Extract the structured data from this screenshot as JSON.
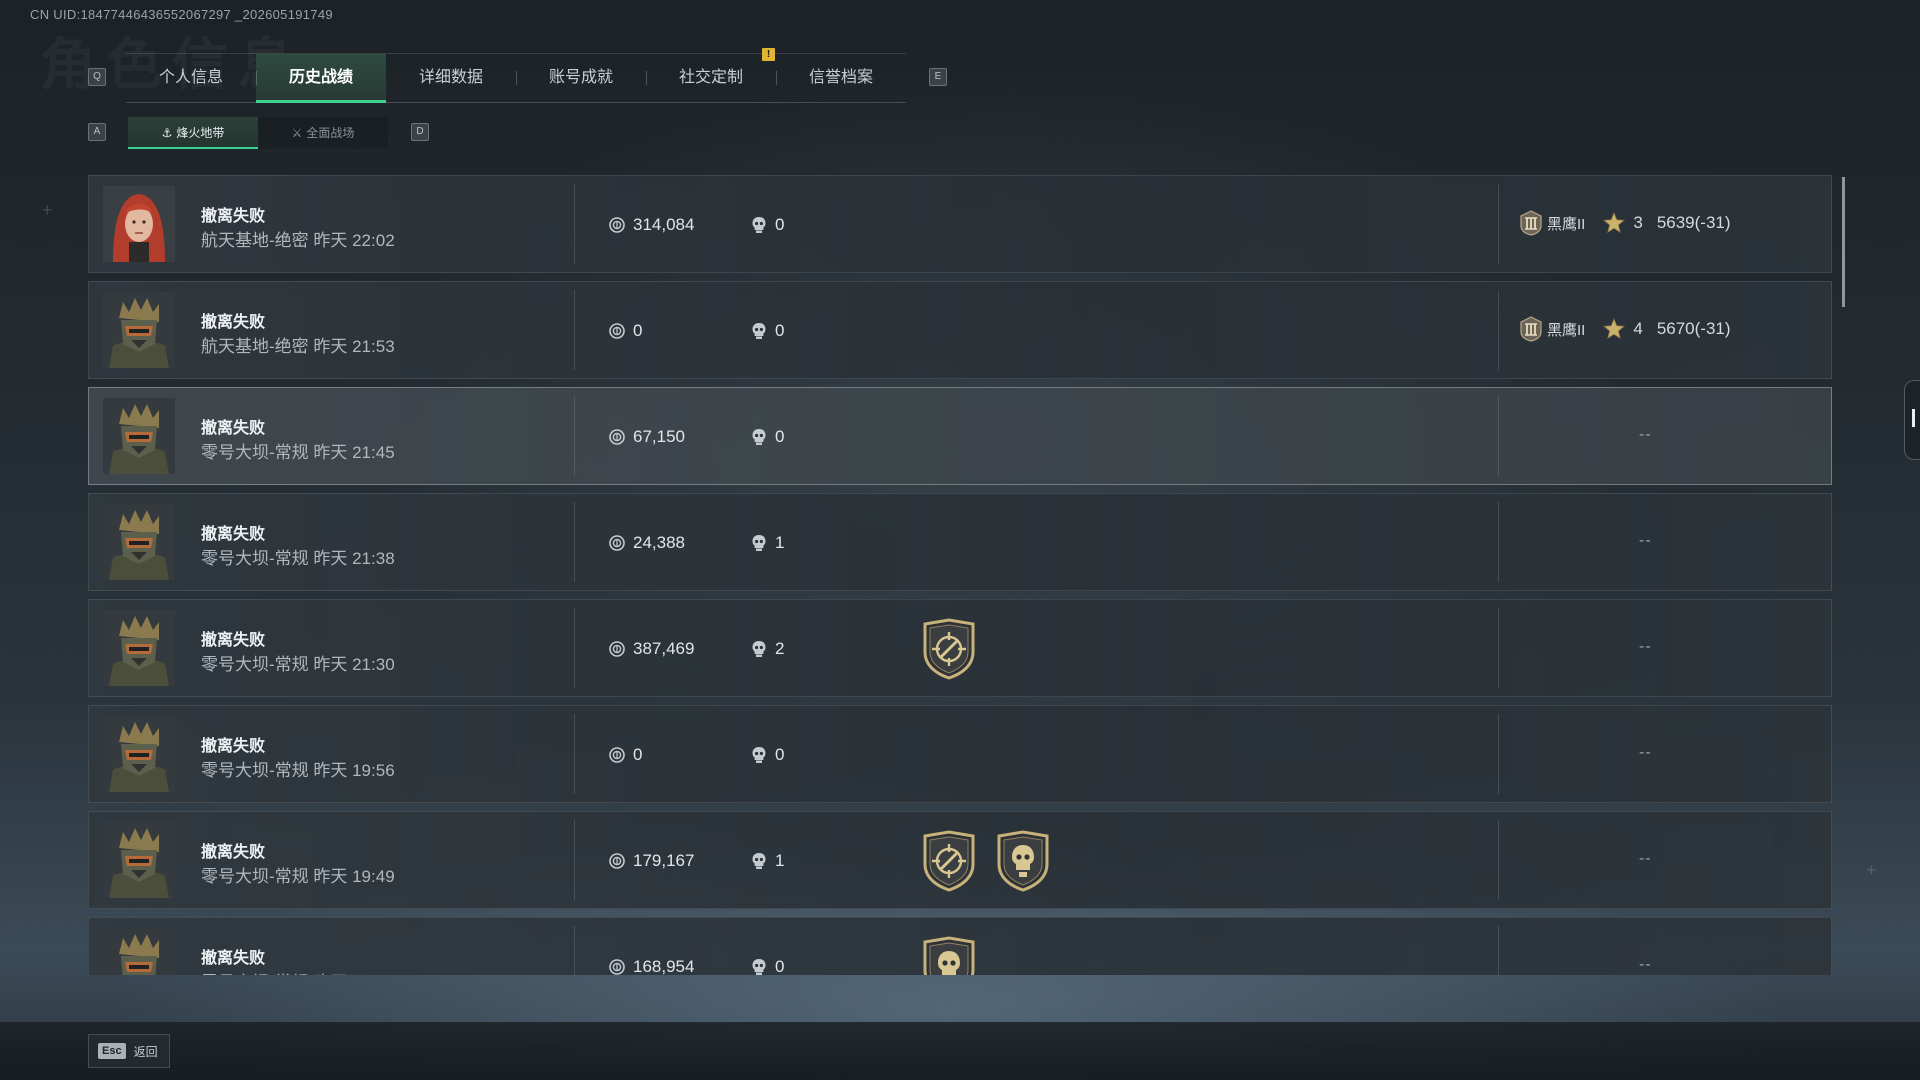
{
  "uid_text": "CN UID:18477446436552067297 _202605191749",
  "watermark": "角色信息",
  "keys": {
    "tab_prev": "Q",
    "tab_next": "E",
    "sub_prev": "A",
    "sub_next": "D"
  },
  "tabs": [
    {
      "label": "个人信息",
      "active": false
    },
    {
      "label": "历史战绩",
      "active": true
    },
    {
      "label": "详细数据",
      "active": false
    },
    {
      "label": "账号成就",
      "active": false
    },
    {
      "label": "社交定制",
      "active": false
    },
    {
      "label": "信誉档案",
      "active": false
    }
  ],
  "tab_alert": "!",
  "subtabs": [
    {
      "label": "烽火地带",
      "icon": "warzone-icon",
      "active": true
    },
    {
      "label": "全面战场",
      "icon": "battlefield-icon",
      "active": false
    }
  ],
  "rows": [
    {
      "status": "撤离失败",
      "map": "航天基地-绝密 昨天 22:02",
      "avatar": "female-operator",
      "money": "314,084",
      "kills": "0",
      "badges": [],
      "rank_name": "黑鹰II",
      "stars": "3",
      "score": "5639(-31)",
      "dash": "",
      "highlight": false
    },
    {
      "status": "撤离失败",
      "map": "航天基地-绝密 昨天 21:53",
      "avatar": "masked-operator",
      "money": "0",
      "kills": "0",
      "badges": [],
      "rank_name": "黑鹰II",
      "stars": "4",
      "score": "5670(-31)",
      "dash": "",
      "highlight": false
    },
    {
      "status": "撤离失败",
      "map": "零号大坝-常规 昨天 21:45",
      "avatar": "masked-operator",
      "money": "67,150",
      "kills": "0",
      "badges": [],
      "rank_name": "",
      "stars": "",
      "score": "",
      "dash": "--",
      "highlight": true
    },
    {
      "status": "撤离失败",
      "map": "零号大坝-常规 昨天 21:38",
      "avatar": "masked-operator",
      "money": "24,388",
      "kills": "1",
      "badges": [],
      "rank_name": "",
      "stars": "",
      "score": "",
      "dash": "--",
      "highlight": false
    },
    {
      "status": "撤离失败",
      "map": "零号大坝-常规 昨天 21:30",
      "avatar": "masked-operator",
      "money": "387,469",
      "kills": "2",
      "badges": [
        "crosshair-badge"
      ],
      "rank_name": "",
      "stars": "",
      "score": "",
      "dash": "--",
      "highlight": false
    },
    {
      "status": "撤离失败",
      "map": "零号大坝-常规 昨天 19:56",
      "avatar": "masked-operator",
      "money": "0",
      "kills": "0",
      "badges": [],
      "rank_name": "",
      "stars": "",
      "score": "",
      "dash": "--",
      "highlight": false
    },
    {
      "status": "撤离失败",
      "map": "零号大坝-常规 昨天 19:49",
      "avatar": "masked-operator",
      "money": "179,167",
      "kills": "1",
      "badges": [
        "crosshair-badge",
        "skull-badge"
      ],
      "rank_name": "",
      "stars": "",
      "score": "",
      "dash": "--",
      "highlight": false
    },
    {
      "status": "撤离失败",
      "map": "零号大坝-常规 昨天 ",
      "avatar": "masked-operator",
      "money": "168,954",
      "kills": "0",
      "badges": [
        "skull-badge"
      ],
      "rank_name": "",
      "stars": "",
      "score": "",
      "dash": "--",
      "highlight": false
    }
  ],
  "footer": {
    "esc_key": "Esc",
    "back_label": "返回"
  },
  "colors": {
    "accent": "#3dcf8e",
    "alert": "#e0b534",
    "badge_gold": "#c7b27a"
  }
}
